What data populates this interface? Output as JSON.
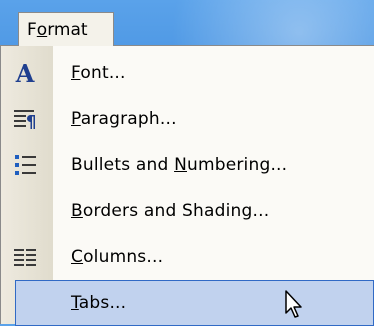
{
  "menu": {
    "title_prefix": "F",
    "title_underlined": "o",
    "title_suffix": "rmat"
  },
  "items": [
    {
      "icon": "font-A-icon",
      "prefix": "",
      "underlined": "F",
      "suffix": "ont..."
    },
    {
      "icon": "paragraph-icon",
      "prefix": "",
      "underlined": "P",
      "suffix": "aragraph..."
    },
    {
      "icon": "bullets-icon",
      "prefix": "Bullets and ",
      "underlined": "N",
      "suffix": "umbering..."
    },
    {
      "icon": "",
      "prefix": "",
      "underlined": "B",
      "suffix": "orders and Shading..."
    },
    {
      "icon": "columns-icon",
      "prefix": "",
      "underlined": "C",
      "suffix": "olumns..."
    },
    {
      "icon": "",
      "prefix": "",
      "underlined": "T",
      "suffix": "abs...",
      "selected": true
    }
  ]
}
